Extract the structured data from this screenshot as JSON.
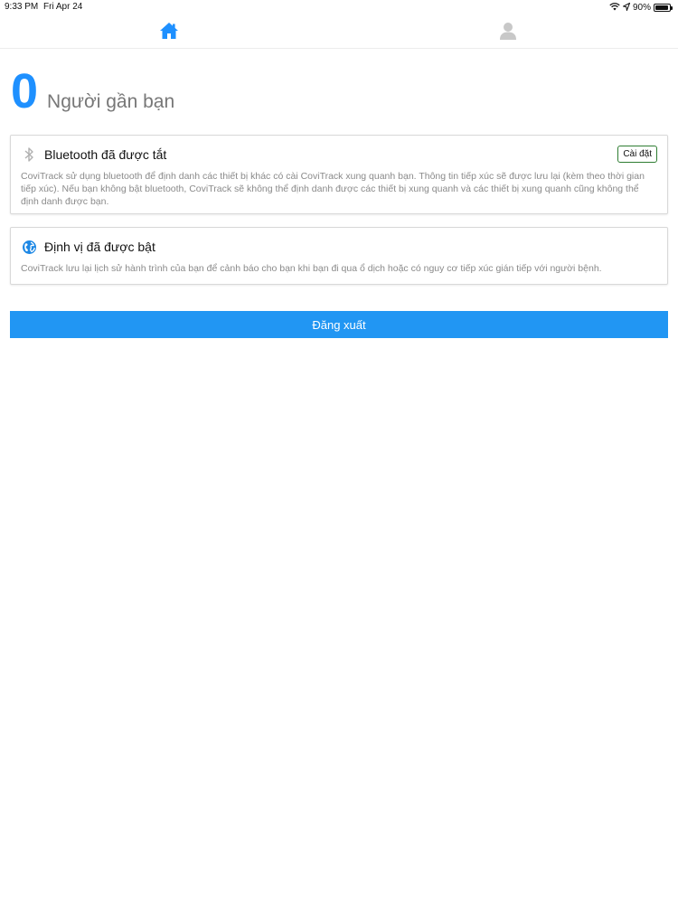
{
  "status": {
    "time": "9:33 PM",
    "date": "Fri Apr 24",
    "battery": "90%",
    "battery_level": 0.9
  },
  "tabs": [
    {
      "name": "home",
      "icon": "home-icon",
      "active": true,
      "color": "#1e90ff"
    },
    {
      "name": "profile",
      "icon": "person-icon",
      "active": false,
      "color": "#c8c8c8"
    }
  ],
  "nearby": {
    "count": "0",
    "label": "Người gần bạn"
  },
  "bluetooth_card": {
    "icon": "bluetooth-icon",
    "title": "Bluetooth đã được tắt",
    "setup_label": "Cài đặt",
    "description": "CoviTrack sử dụng bluetooth để định danh các thiết bị khác có cài CoviTrack xung quanh bạn. Thông tin tiếp xúc sẽ được lưu lại (kèm theo thời gian tiếp xúc). Nếu bạn không bật bluetooth, CoviTrack sẽ không thể định danh được các thiết bị xung quanh và các thiết bị xung quanh cũng không thể định danh được bạn."
  },
  "location_card": {
    "icon": "globe-icon",
    "title": "Định vị đã được bật",
    "description": "CoviTrack lưu lại lịch sử hành trình của bạn để cảnh báo cho bạn khi bạn đi qua ổ dịch hoặc có nguy cơ tiếp xúc gián tiếp với người bệnh."
  },
  "logout_label": "Đăng xuất",
  "colors": {
    "accent": "#1e90ff",
    "button": "#2196f3",
    "setup_border": "#2e7d32"
  }
}
